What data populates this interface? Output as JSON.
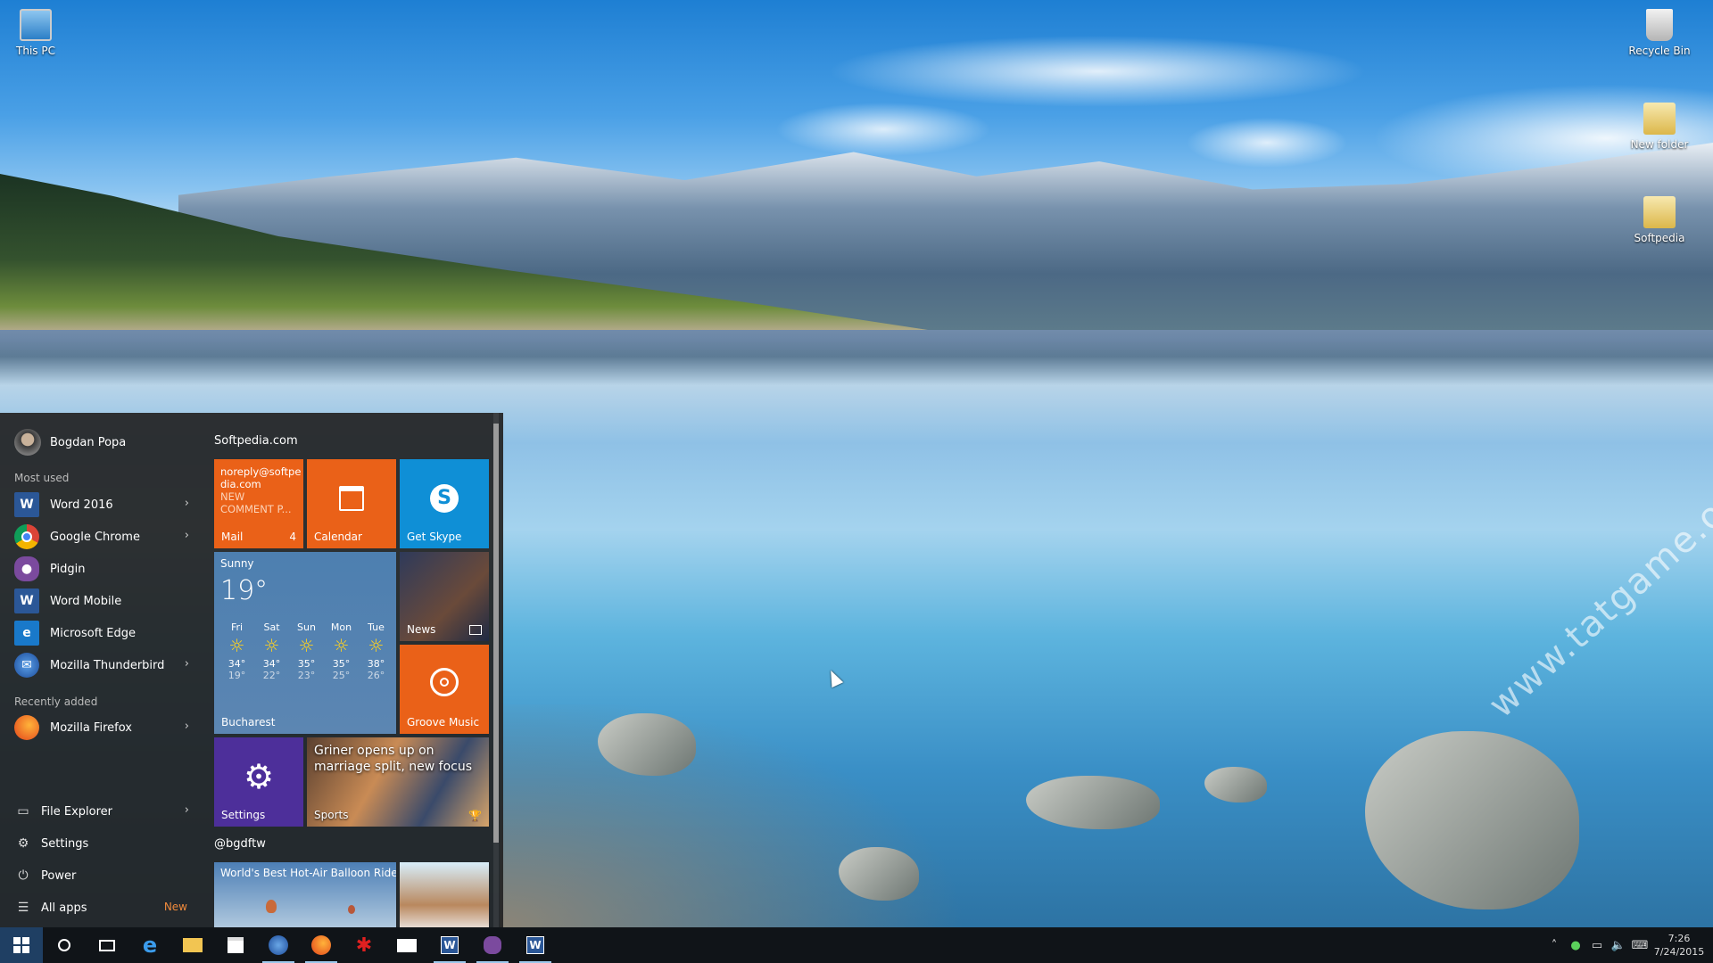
{
  "desktop": {
    "icons": [
      {
        "label": "This PC"
      },
      {
        "label": "Recycle Bin"
      },
      {
        "label": "New folder"
      },
      {
        "label": "Softpedia"
      }
    ],
    "watermark": "www.tatgame.org"
  },
  "start_menu": {
    "user_name": "Bogdan Popa",
    "most_used_label": "Most used",
    "most_used": [
      {
        "label": "Word 2016",
        "icon": "word-icon",
        "color": "#2b5797",
        "has_arrow": true
      },
      {
        "label": "Google Chrome",
        "icon": "chrome-icon",
        "color": "#e8b400",
        "has_arrow": true
      },
      {
        "label": "Pidgin",
        "icon": "pidgin-icon",
        "color": "#7b4a9e",
        "has_arrow": false
      },
      {
        "label": "Word Mobile",
        "icon": "word-mobile-icon",
        "color": "#2b5797",
        "has_arrow": false
      },
      {
        "label": "Microsoft Edge",
        "icon": "edge-icon",
        "color": "#1979ca",
        "has_arrow": false
      },
      {
        "label": "Mozilla Thunderbird",
        "icon": "thunderbird-icon",
        "color": "#2e62a8",
        "has_arrow": true
      }
    ],
    "recently_added_label": "Recently added",
    "recently_added": [
      {
        "label": "Mozilla Firefox",
        "icon": "firefox-icon",
        "color": "#e66a17",
        "has_arrow": true
      }
    ],
    "system": [
      {
        "label": "File Explorer",
        "icon": "folder-icon",
        "has_arrow": true
      },
      {
        "label": "Settings",
        "icon": "gear-icon",
        "has_arrow": false
      },
      {
        "label": "Power",
        "icon": "power-icon",
        "has_arrow": false
      },
      {
        "label": "All apps",
        "icon": "list-icon",
        "badge": "New"
      }
    ]
  },
  "tiles": {
    "group1_label": "Softpedia.com",
    "group2_label": "@bgdftw",
    "mail": {
      "from": "noreply@softpe dia.com",
      "line1": "NEW",
      "line2": "COMMENT P...",
      "label": "Mail",
      "count": "4"
    },
    "calendar": {
      "label": "Calendar"
    },
    "skype": {
      "label": "Get Skype"
    },
    "weather": {
      "condition": "Sunny",
      "temp": "19°",
      "location": "Bucharest",
      "days": [
        {
          "day": "Fri",
          "high": "34°",
          "low": "19°"
        },
        {
          "day": "Sat",
          "high": "34°",
          "low": "22°"
        },
        {
          "day": "Sun",
          "high": "35°",
          "low": "23°"
        },
        {
          "day": "Mon",
          "high": "35°",
          "low": "25°"
        },
        {
          "day": "Tue",
          "high": "38°",
          "low": "26°"
        }
      ]
    },
    "news": {
      "label": "News"
    },
    "groove": {
      "label": "Groove Music"
    },
    "settings": {
      "label": "Settings"
    },
    "sports": {
      "headline": "Griner opens up on marriage split, new focus",
      "label": "Sports"
    },
    "balloon": {
      "headline": "World's Best Hot-Air Balloon Rides"
    }
  },
  "taskbar": {
    "apps": [
      {
        "icon": "windows-start-icon",
        "active": false
      },
      {
        "icon": "search-icon",
        "active": false
      },
      {
        "icon": "task-view-icon",
        "active": false
      },
      {
        "icon": "edge-icon",
        "active": false
      },
      {
        "icon": "file-explorer-icon",
        "active": false
      },
      {
        "icon": "store-icon",
        "active": false
      },
      {
        "icon": "thunderbird-icon",
        "active": true
      },
      {
        "icon": "firefox-icon",
        "active": true
      },
      {
        "icon": "app-red-icon",
        "active": false
      },
      {
        "icon": "mail-icon",
        "active": false
      },
      {
        "icon": "word-icon",
        "active": true
      },
      {
        "icon": "pidgin-icon",
        "active": true
      },
      {
        "icon": "word-icon",
        "active": true
      }
    ],
    "time": "7:26",
    "date": "7/24/2015"
  }
}
